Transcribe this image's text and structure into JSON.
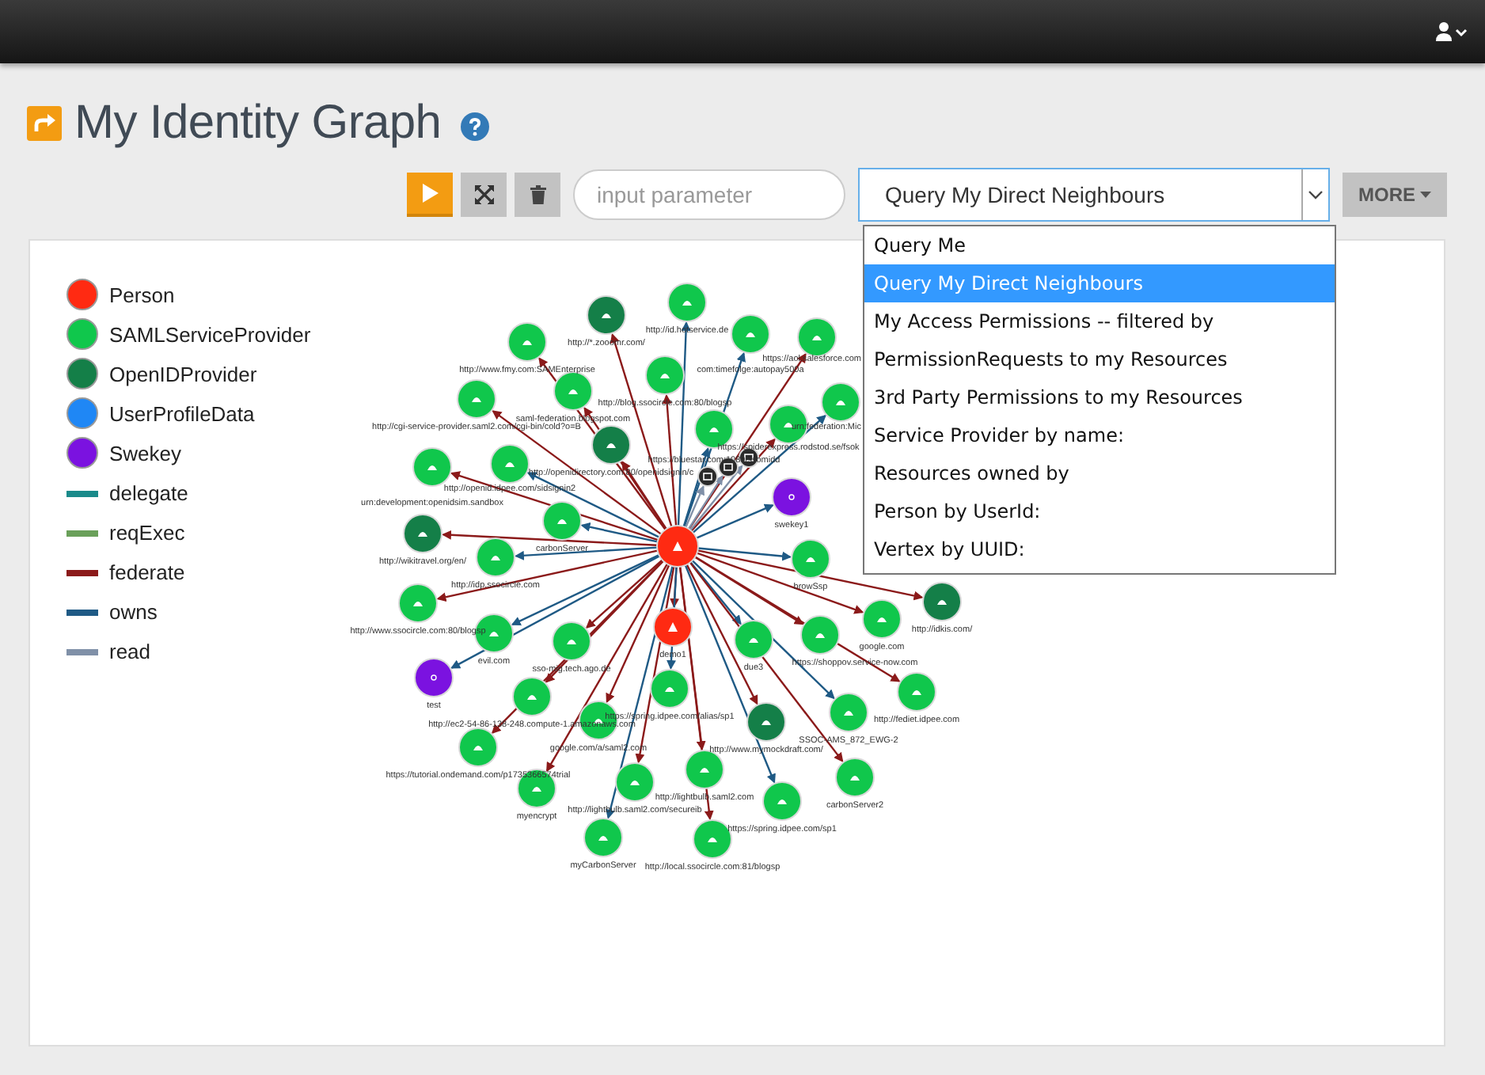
{
  "page": {
    "title": "My Identity Graph"
  },
  "toolbar": {
    "input": {
      "placeholder": "input parameter"
    },
    "query_select": {
      "value": "Query My Direct Neighbours"
    },
    "more_button": "MORE"
  },
  "query_menu": {
    "items": [
      {
        "label": "Query Me",
        "selected": false
      },
      {
        "label": "Query My Direct Neighbours",
        "selected": true
      },
      {
        "label": "My Access Permissions -- filtered by",
        "selected": false
      },
      {
        "label": "PermissionRequests to my Resources",
        "selected": false
      },
      {
        "label": "3rd Party Permissions to my Resources",
        "selected": false
      },
      {
        "label": "Service Provider by name:",
        "selected": false
      },
      {
        "label": "Resources owned by",
        "selected": false
      },
      {
        "label": "Person by UserId:",
        "selected": false
      },
      {
        "label": "Vertex by UUID:",
        "selected": false
      }
    ]
  },
  "legend": [
    {
      "kind": "node",
      "label": "Person",
      "color": "#ff2a12"
    },
    {
      "kind": "node",
      "label": "SAMLServiceProvider",
      "color": "#10c74c"
    },
    {
      "kind": "node",
      "label": "OpenIDProvider",
      "color": "#147f48"
    },
    {
      "kind": "node",
      "label": "UserProfileData",
      "color": "#1f87f5"
    },
    {
      "kind": "node",
      "label": "Swekey",
      "color": "#7b12e0"
    },
    {
      "kind": "edge",
      "label": "delegate",
      "color": "#1a8a8a"
    },
    {
      "kind": "edge",
      "label": "reqExec",
      "color": "#6aa05a"
    },
    {
      "kind": "edge",
      "label": "federate",
      "color": "#8b1a1a"
    },
    {
      "kind": "edge",
      "label": "owns",
      "color": "#1f5a85"
    },
    {
      "kind": "edge",
      "label": "read",
      "color": "#8090a8"
    }
  ],
  "graph": {
    "center": {
      "kind": "person"
    },
    "nodes": [
      {
        "kind": "openid",
        "label": "http://*.zooomr.com/",
        "edge": {
          "kind": "federate"
        }
      },
      {
        "kind": "saml",
        "label": "http://id.hotservice.de",
        "edge": {
          "kind": "owns"
        }
      },
      {
        "kind": "saml",
        "label": "com:timefolge:autopay500a",
        "edge": {
          "kind": "owns"
        }
      },
      {
        "kind": "saml",
        "label": "https://aol.salesforce.com",
        "edge": {
          "kind": "federate"
        }
      },
      {
        "kind": "saml",
        "label": "http://www.fmy.com:SAMEnterprise",
        "edge": {
          "kind": "federate"
        }
      },
      {
        "kind": "saml",
        "label": "http://blog.ssocircle.com:80/blogsp",
        "edge": {
          "kind": "federate"
        }
      },
      {
        "kind": "saml",
        "label": "saml-federation.blogspot.com",
        "edge": {
          "kind": "federate"
        }
      },
      {
        "kind": "saml",
        "label": "http://cgi-service-provider.saml2.com/cgi-bin/cold?o=B",
        "edge": {
          "kind": "federate"
        }
      },
      {
        "kind": "openid",
        "label": "http://openidirectory.com:80/openidsignin/c",
        "edge": {
          "kind": "federate"
        }
      },
      {
        "kind": "saml",
        "label": "https://bluestar.com:1089/ssomidd",
        "edge": {
          "kind": "owns"
        }
      },
      {
        "kind": "saml",
        "label": "urn:federation:Mic",
        "edge": {
          "kind": "owns"
        }
      },
      {
        "kind": "saml",
        "label": "https://spiderexpress.rodstod.se/fsok",
        "edge": {
          "kind": "federate"
        }
      },
      {
        "kind": "saml",
        "label": "urn:development:openidsim.sandbox",
        "edge": {
          "kind": "federate"
        }
      },
      {
        "kind": "saml",
        "label": "http://openid.idpee.com/sidsignin2",
        "edge": {
          "kind": "owns"
        }
      },
      {
        "kind": "saml",
        "label": "carbonServer",
        "edge": {
          "kind": "owns"
        }
      },
      {
        "kind": "openid",
        "label": "http://wikitravel.org/en/",
        "edge": {
          "kind": "federate"
        }
      },
      {
        "kind": "saml",
        "label": "http://idp.ssocircle.com",
        "edge": {
          "kind": "owns"
        }
      },
      {
        "kind": "swekey",
        "label": "swekey1",
        "edge": {
          "kind": "owns"
        }
      },
      {
        "kind": "saml",
        "label": "browSsp",
        "edge": {
          "kind": "owns"
        }
      },
      {
        "kind": "openid",
        "label": "http://idkis.com/",
        "edge": {
          "kind": "federate"
        }
      },
      {
        "kind": "saml",
        "label": "google.com",
        "edge": {
          "kind": "federate"
        }
      },
      {
        "kind": "saml",
        "label": "http://www.ssocircle.com:80/blogsp",
        "edge": {
          "kind": "federate"
        }
      },
      {
        "kind": "saml",
        "label": "evil.com",
        "edge": {
          "kind": "owns"
        }
      },
      {
        "kind": "saml",
        "label": "sso-mig.tech.ago.de",
        "edge": {
          "kind": "federate"
        }
      },
      {
        "kind": "person",
        "label": "demo1",
        "edge": {
          "kind": "federate"
        }
      },
      {
        "kind": "saml",
        "label": "due3",
        "edge": {
          "kind": "owns"
        }
      },
      {
        "kind": "saml",
        "label": "https://shoppov.service-now.com",
        "edge": {
          "kind": "federate"
        }
      },
      {
        "kind": "swekey",
        "label": "test",
        "edge": {
          "kind": "owns"
        }
      },
      {
        "kind": "saml",
        "label": "http://ec2-54-86-138-248.compute-1.amazonaws.com",
        "edge": {
          "kind": "federate"
        }
      },
      {
        "kind": "saml",
        "label": "https://spring.idpee.com/alias/sp1",
        "edge": {
          "kind": "owns"
        }
      },
      {
        "kind": "saml",
        "label": "google.com/a/saml2.com",
        "edge": {
          "kind": "federate"
        }
      },
      {
        "kind": "openid",
        "label": "http://www.mymockdraft.com/",
        "edge": {
          "kind": "federate"
        }
      },
      {
        "kind": "saml",
        "label": "SSOC-AMS_872_EWG-2",
        "edge": {
          "kind": "owns"
        }
      },
      {
        "kind": "saml",
        "label": "http://fediet.idpee.com",
        "edge": {
          "kind": "federate"
        }
      },
      {
        "kind": "saml",
        "label": "https://tutorial.ondemand.com/p1735366574trial",
        "edge": {
          "kind": "federate"
        }
      },
      {
        "kind": "saml",
        "label": "myencrypt",
        "edge": {
          "kind": "federate"
        }
      },
      {
        "kind": "saml",
        "label": "http://lightbulb.saml2.com/secureib",
        "edge": {
          "kind": "federate"
        }
      },
      {
        "kind": "saml",
        "label": "http://lightbulb.saml2.com",
        "edge": {
          "kind": "federate"
        }
      },
      {
        "kind": "saml",
        "label": "https://spring.idpee.com/sp1",
        "edge": {
          "kind": "owns"
        }
      },
      {
        "kind": "saml",
        "label": "carbonServer2",
        "edge": {
          "kind": "federate"
        }
      },
      {
        "kind": "saml",
        "label": "myCarbonServer",
        "edge": {
          "kind": "owns"
        }
      },
      {
        "kind": "saml",
        "label": "http://local.ssocircle.com:81/blogsp",
        "edge": {
          "kind": "federate"
        }
      },
      {
        "kind": "device",
        "edge": {
          "kind": "read"
        }
      },
      {
        "kind": "device",
        "edge": {
          "kind": "read"
        }
      },
      {
        "kind": "device",
        "edge": {
          "kind": "read"
        }
      }
    ]
  }
}
